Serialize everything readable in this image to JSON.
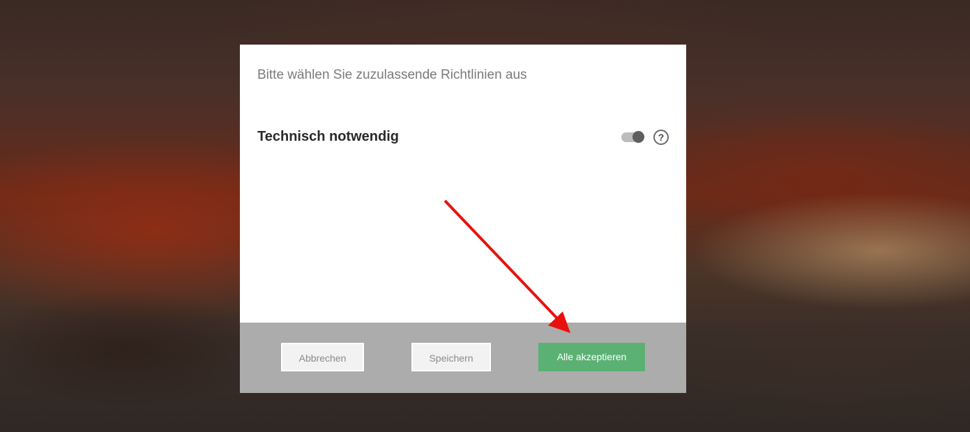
{
  "dialog": {
    "title": "Bitte wählen Sie zuzulassende Richtlinien aus",
    "policies": [
      {
        "label": "Technisch notwendig",
        "enabled": true,
        "help_icon": "question-circle-icon"
      }
    ]
  },
  "footer": {
    "cancel_label": "Abbrechen",
    "save_label": "Speichern",
    "accept_all_label": "Alle akzeptieren"
  },
  "colors": {
    "accept_button": "#5bb174",
    "footer_background": "#acacac",
    "annotation_arrow": "#e8120c"
  }
}
